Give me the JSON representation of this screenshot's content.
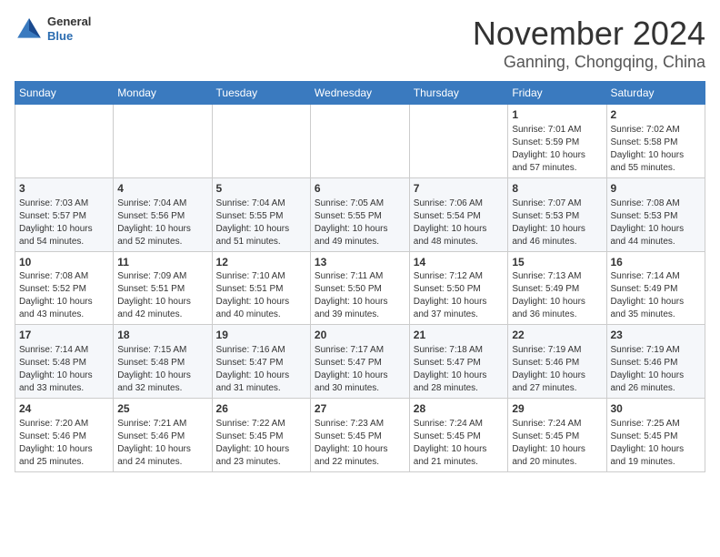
{
  "header": {
    "logo_general": "General",
    "logo_blue": "Blue",
    "month": "November 2024",
    "location": "Ganning, Chongqing, China"
  },
  "weekdays": [
    "Sunday",
    "Monday",
    "Tuesday",
    "Wednesday",
    "Thursday",
    "Friday",
    "Saturday"
  ],
  "weeks": [
    [
      {
        "day": "",
        "info": ""
      },
      {
        "day": "",
        "info": ""
      },
      {
        "day": "",
        "info": ""
      },
      {
        "day": "",
        "info": ""
      },
      {
        "day": "",
        "info": ""
      },
      {
        "day": "1",
        "info": "Sunrise: 7:01 AM\nSunset: 5:59 PM\nDaylight: 10 hours\nand 57 minutes."
      },
      {
        "day": "2",
        "info": "Sunrise: 7:02 AM\nSunset: 5:58 PM\nDaylight: 10 hours\nand 55 minutes."
      }
    ],
    [
      {
        "day": "3",
        "info": "Sunrise: 7:03 AM\nSunset: 5:57 PM\nDaylight: 10 hours\nand 54 minutes."
      },
      {
        "day": "4",
        "info": "Sunrise: 7:04 AM\nSunset: 5:56 PM\nDaylight: 10 hours\nand 52 minutes."
      },
      {
        "day": "5",
        "info": "Sunrise: 7:04 AM\nSunset: 5:55 PM\nDaylight: 10 hours\nand 51 minutes."
      },
      {
        "day": "6",
        "info": "Sunrise: 7:05 AM\nSunset: 5:55 PM\nDaylight: 10 hours\nand 49 minutes."
      },
      {
        "day": "7",
        "info": "Sunrise: 7:06 AM\nSunset: 5:54 PM\nDaylight: 10 hours\nand 48 minutes."
      },
      {
        "day": "8",
        "info": "Sunrise: 7:07 AM\nSunset: 5:53 PM\nDaylight: 10 hours\nand 46 minutes."
      },
      {
        "day": "9",
        "info": "Sunrise: 7:08 AM\nSunset: 5:53 PM\nDaylight: 10 hours\nand 44 minutes."
      }
    ],
    [
      {
        "day": "10",
        "info": "Sunrise: 7:08 AM\nSunset: 5:52 PM\nDaylight: 10 hours\nand 43 minutes."
      },
      {
        "day": "11",
        "info": "Sunrise: 7:09 AM\nSunset: 5:51 PM\nDaylight: 10 hours\nand 42 minutes."
      },
      {
        "day": "12",
        "info": "Sunrise: 7:10 AM\nSunset: 5:51 PM\nDaylight: 10 hours\nand 40 minutes."
      },
      {
        "day": "13",
        "info": "Sunrise: 7:11 AM\nSunset: 5:50 PM\nDaylight: 10 hours\nand 39 minutes."
      },
      {
        "day": "14",
        "info": "Sunrise: 7:12 AM\nSunset: 5:50 PM\nDaylight: 10 hours\nand 37 minutes."
      },
      {
        "day": "15",
        "info": "Sunrise: 7:13 AM\nSunset: 5:49 PM\nDaylight: 10 hours\nand 36 minutes."
      },
      {
        "day": "16",
        "info": "Sunrise: 7:14 AM\nSunset: 5:49 PM\nDaylight: 10 hours\nand 35 minutes."
      }
    ],
    [
      {
        "day": "17",
        "info": "Sunrise: 7:14 AM\nSunset: 5:48 PM\nDaylight: 10 hours\nand 33 minutes."
      },
      {
        "day": "18",
        "info": "Sunrise: 7:15 AM\nSunset: 5:48 PM\nDaylight: 10 hours\nand 32 minutes."
      },
      {
        "day": "19",
        "info": "Sunrise: 7:16 AM\nSunset: 5:47 PM\nDaylight: 10 hours\nand 31 minutes."
      },
      {
        "day": "20",
        "info": "Sunrise: 7:17 AM\nSunset: 5:47 PM\nDaylight: 10 hours\nand 30 minutes."
      },
      {
        "day": "21",
        "info": "Sunrise: 7:18 AM\nSunset: 5:47 PM\nDaylight: 10 hours\nand 28 minutes."
      },
      {
        "day": "22",
        "info": "Sunrise: 7:19 AM\nSunset: 5:46 PM\nDaylight: 10 hours\nand 27 minutes."
      },
      {
        "day": "23",
        "info": "Sunrise: 7:19 AM\nSunset: 5:46 PM\nDaylight: 10 hours\nand 26 minutes."
      }
    ],
    [
      {
        "day": "24",
        "info": "Sunrise: 7:20 AM\nSunset: 5:46 PM\nDaylight: 10 hours\nand 25 minutes."
      },
      {
        "day": "25",
        "info": "Sunrise: 7:21 AM\nSunset: 5:46 PM\nDaylight: 10 hours\nand 24 minutes."
      },
      {
        "day": "26",
        "info": "Sunrise: 7:22 AM\nSunset: 5:45 PM\nDaylight: 10 hours\nand 23 minutes."
      },
      {
        "day": "27",
        "info": "Sunrise: 7:23 AM\nSunset: 5:45 PM\nDaylight: 10 hours\nand 22 minutes."
      },
      {
        "day": "28",
        "info": "Sunrise: 7:24 AM\nSunset: 5:45 PM\nDaylight: 10 hours\nand 21 minutes."
      },
      {
        "day": "29",
        "info": "Sunrise: 7:24 AM\nSunset: 5:45 PM\nDaylight: 10 hours\nand 20 minutes."
      },
      {
        "day": "30",
        "info": "Sunrise: 7:25 AM\nSunset: 5:45 PM\nDaylight: 10 hours\nand 19 minutes."
      }
    ]
  ]
}
